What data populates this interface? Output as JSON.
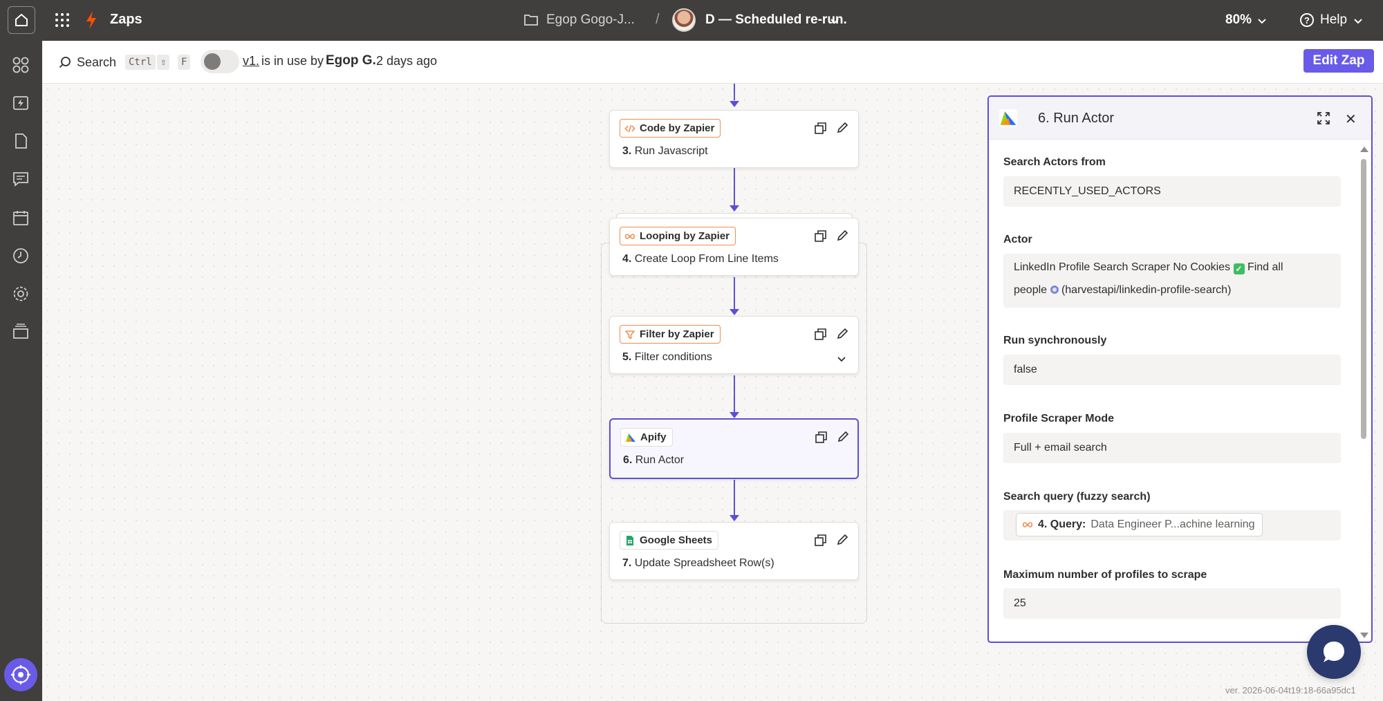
{
  "topbar": {
    "app_name": "Zaps",
    "folder_name": "Egop Gogo-J...",
    "separator": "/",
    "zap_name": "D — Scheduled re-run.",
    "zoom": "80%",
    "help": "Help"
  },
  "toolbar": {
    "search_label": "Search",
    "shortcut_keys": [
      "Ctrl",
      "⇧",
      "F"
    ],
    "version_link": "v1.",
    "usage_text": "is in use by",
    "user_name": "Egop G.",
    "time_ago": "2 days ago",
    "edit_button": "Edit Zap"
  },
  "steps": [
    {
      "app": "Code by Zapier",
      "number": "3.",
      "title": "Run Javascript",
      "icon": "code-icon",
      "accent": "#f08d4f"
    },
    {
      "app": "Looping by Zapier",
      "number": "4.",
      "title": "Create Loop From Line Items",
      "icon": "loop-icon",
      "accent": "#f08d4f"
    },
    {
      "app": "Filter by Zapier",
      "number": "5.",
      "title": "Filter conditions",
      "icon": "filter-icon",
      "accent": "#f08d4f"
    },
    {
      "app": "Apify",
      "number": "6.",
      "title": "Run Actor",
      "icon": "apify-icon",
      "selected": true
    },
    {
      "app": "Google Sheets",
      "number": "7.",
      "title": "Update Spreadsheet Row(s)",
      "icon": "sheets-icon"
    }
  ],
  "panel": {
    "title": "6. Run Actor",
    "fields": [
      {
        "label": "Search Actors from",
        "value": "RECENTLY_USED_ACTORS"
      },
      {
        "label": "Actor",
        "value_part1": "LinkedIn Profile Search Scraper No Cookies",
        "value_part2": "Find all",
        "value_part3": "people",
        "value_part4": "(harvestapi/linkedin-profile-search)"
      },
      {
        "label": "Run synchronously",
        "value": "false"
      },
      {
        "label": "Profile Scraper Mode",
        "value": "Full + email search"
      },
      {
        "label": "Search query (fuzzy search)",
        "pill_ref": "4. Query:",
        "pill_value": "Data Engineer P...achine learning"
      },
      {
        "label": "Maximum number of profiles to scrape",
        "value": "25"
      }
    ]
  },
  "footer": {
    "version": "ver. 2026-06-04t19:18-66a95dc1"
  },
  "colors": {
    "accent": "#5b4fd6",
    "brand_button": "#695be8",
    "zapier_orange": "#ff4f00",
    "topbar": "#403f3e"
  }
}
